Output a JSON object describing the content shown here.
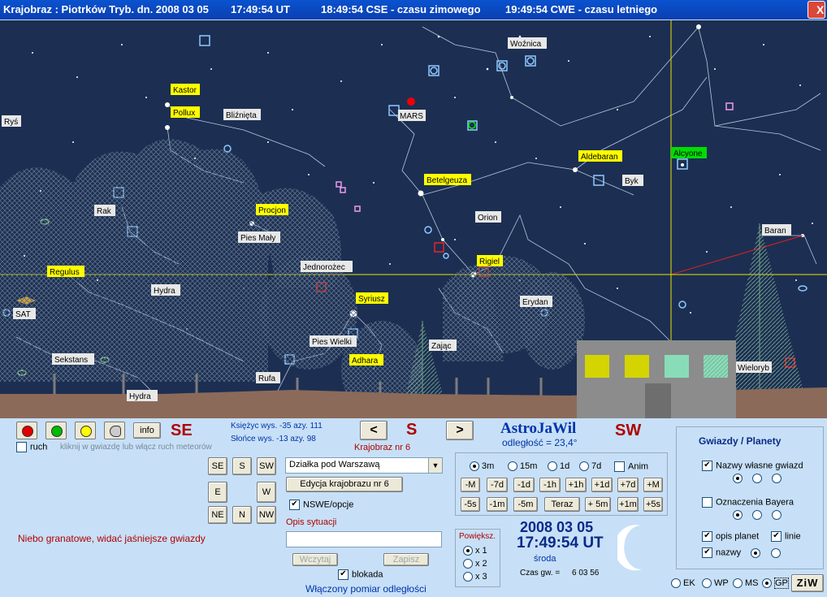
{
  "title": {
    "location": "Krajobraz : Piotrków Tryb. dn. 2008 03 05",
    "ut": "17:49:54 UT",
    "cse": "18:49:54 CSE - czasu zimowego",
    "cwe": "19:49:54 CWE - czasu letniego",
    "close": "X"
  },
  "sky_labels": {
    "wozniaca": "Woźnica",
    "kastor": "Kastor",
    "pollux": "Pollux",
    "blizneta": "Bliźnięta",
    "mars": "MARS",
    "rys": "Ryś",
    "aldebaran": "Aldebaran",
    "alcyone": "Alcyone",
    "byk": "Byk",
    "betelgeuza": "Betelgeuza",
    "rak": "Rak",
    "procjon": "Procjon",
    "orion": "Orion",
    "pies_maly": "Pies Mały",
    "baran": "Baran",
    "regulus": "Regulus",
    "jednorozec": "Jednorożec",
    "rigiel": "Rigiel",
    "hydra": "Hydra",
    "syriusz": "Syriusz",
    "erydan": "Erydan",
    "sat": "SAT",
    "pies_wielki": "Pies Wielki",
    "zajac": "Zając",
    "sekstans": "Sekstans",
    "adhara": "Adhara",
    "rufa": "Rufa",
    "hydra2": "Hydra",
    "wieloryb": "Wieloryb"
  },
  "controls": {
    "info": "info",
    "dir_left": "SE",
    "dir_center": "S",
    "dir_right": "SW",
    "ruch": "ruch",
    "hint": "kliknij w gwiazdę lub włącz ruch meteorów",
    "moon_line": "Księżyc wys. -35    azy. 111",
    "sun_line": "Słońce wys. -13    azy. 98",
    "prev": "<",
    "next": ">",
    "landscape_nr": "Krajobraz nr 6",
    "app_name": "AstroJaWil",
    "distance": "odległość = 23,4°",
    "nav_buttons": [
      "SE",
      "S",
      "SW",
      "E",
      "W",
      "NE",
      "N",
      "NW"
    ],
    "landscape_select": "Działka pod Warszawą",
    "edit_button": "Edycja krajobrazu nr 6",
    "nswe_opcje": "NSWE/opcje",
    "opis_label": "Opis sytuacji",
    "opis_value": "",
    "wczytaj": "Wczytaj",
    "zapisz": "Zapisz",
    "blokada": "blokada",
    "status_left": "Niebo granatowe, widać jaśniejsze gwiazdy",
    "status_bottom": "Włączony pomiar odległości",
    "step_radios": [
      "3m",
      "15m",
      "1d",
      "7d"
    ],
    "anim": "Anim",
    "step_row1": [
      "-M",
      "-7d",
      "-1d",
      "-1h",
      "+1h",
      "+1d",
      "+7d",
      "+M"
    ],
    "step_row2": [
      "-5s",
      "-1m",
      "-5m",
      "Teraz",
      "+ 5m",
      "+1m",
      "+5s"
    ],
    "zoom_label": "Powiększ.",
    "zoom_options": [
      "x 1",
      "x 2",
      "x 3"
    ],
    "date": "2008 03 05",
    "time": "17:49:54 UT",
    "weekday": "środa",
    "sidereal_label": "Czas gw. =",
    "sidereal_value": "6 03 56",
    "right_title": "Gwiazdy / Planety",
    "opt_names": "Nazwy własne gwiazd",
    "opt_bayer": "Oznaczenia Bayera",
    "opt_planets": "opis planet",
    "opt_lines": "linie",
    "opt_nazwy": "nazwy",
    "bottom_radios": [
      "EK",
      "WP",
      "MS",
      "GP"
    ],
    "ziw": "ZiW"
  },
  "colors": {
    "sky": "#1c2f52",
    "ground": "#8b6a5a",
    "label_yellow": "#ffff00",
    "label_white": "#e8e8e8",
    "label_green": "#00dd00",
    "title_blue": "#0a4ec8",
    "accent_red": "#b00000"
  }
}
